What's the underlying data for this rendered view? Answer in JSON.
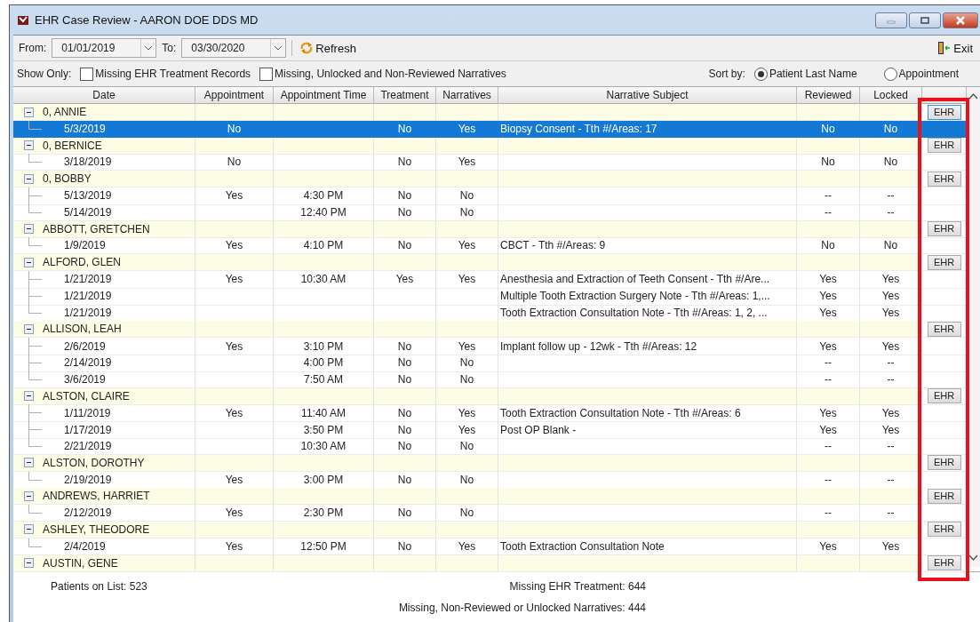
{
  "window": {
    "title": "EHR Case Review - AARON DOE DDS MD"
  },
  "toolbar": {
    "from_label": "From:",
    "from_date": "01/01/2019",
    "to_label": "To:",
    "to_date": "03/30/2020",
    "refresh": "Refresh",
    "exit": "Exit"
  },
  "filters": {
    "show_only_label": "Show Only:",
    "checkboxes": [
      {
        "label": "Missing EHR Treatment Records",
        "checked": false
      },
      {
        "label": "Missing, Unlocked and Non-Reviewed Narratives",
        "checked": false
      }
    ],
    "sort_label": "Sort by:",
    "sort_options": [
      {
        "label": "Patient Last Name",
        "selected": true
      },
      {
        "label": "Appointment",
        "selected": false
      }
    ]
  },
  "table": {
    "columns": [
      "Date",
      "Appointment",
      "Appointment Time",
      "Treatment",
      "Narratives",
      "Narrative Subject",
      "Reviewed",
      "Locked"
    ],
    "ehr_column_highlighted": true,
    "patients": [
      {
        "name": "0, ANNIE",
        "expanded": true,
        "ehr_button": "EHR",
        "focused": true,
        "visits": [
          {
            "date": "5/3/2019",
            "appointment": "No",
            "treatment": "No",
            "narratives": "Yes",
            "subject": "Biopsy Consent - Tth #/Areas: 17",
            "reviewed": "No",
            "locked": "No",
            "selected": true
          }
        ]
      },
      {
        "name": "0, BERNICE",
        "expanded": true,
        "ehr_button": "EHR",
        "focused": false,
        "visits": [
          {
            "date": "3/18/2019",
            "appointment": "No",
            "treatment": "No",
            "narratives": "Yes",
            "reviewed": "No",
            "locked": "No",
            "selected": false
          }
        ]
      },
      {
        "name": "0, BOBBY",
        "expanded": true,
        "ehr_button": "EHR",
        "focused": false,
        "visits": [
          {
            "date": "5/13/2019",
            "appointment": "Yes",
            "time": "4:30 PM",
            "treatment": "No",
            "narratives": "No",
            "reviewed": "--",
            "locked": "--",
            "selected": false
          },
          {
            "date": "5/14/2019",
            "time": "12:40 PM",
            "treatment": "No",
            "narratives": "No",
            "reviewed": "--",
            "locked": "--",
            "selected": false
          }
        ]
      },
      {
        "name": "ABBOTT, GRETCHEN",
        "expanded": true,
        "ehr_button": "EHR",
        "focused": false,
        "visits": [
          {
            "date": "1/9/2019",
            "appointment": "Yes",
            "time": "4:10 PM",
            "treatment": "No",
            "narratives": "Yes",
            "subject": "CBCT - Tth #/Areas:  9",
            "reviewed": "No",
            "locked": "No",
            "selected": false
          }
        ]
      },
      {
        "name": "ALFORD, GLEN",
        "expanded": true,
        "ehr_button": "EHR",
        "focused": false,
        "visits": [
          {
            "date": "1/21/2019",
            "appointment": "Yes",
            "time": "10:30 AM",
            "treatment": "Yes",
            "narratives": "Yes",
            "subject": "Anesthesia and Extraction of Teeth Consent - Tth #/Are...",
            "reviewed": "Yes",
            "locked": "Yes",
            "selected": false
          },
          {
            "date": "1/21/2019",
            "subject": "Multiple Tooth Extraction Surgery Note - Tth #/Areas: 1,...",
            "reviewed": "Yes",
            "locked": "Yes",
            "selected": false
          },
          {
            "date": "1/21/2019",
            "subject": "Tooth Extraction Consultation Note - Tth #/Areas: 1, 2, ...",
            "reviewed": "Yes",
            "locked": "Yes",
            "selected": false
          }
        ]
      },
      {
        "name": "ALLISON, LEAH",
        "expanded": true,
        "ehr_button": "EHR",
        "focused": false,
        "visits": [
          {
            "date": "2/6/2019",
            "appointment": "Yes",
            "time": "3:10 PM",
            "treatment": "No",
            "narratives": "Yes",
            "subject": "Implant follow up - 12wk - Tth #/Areas: 12",
            "reviewed": "Yes",
            "locked": "Yes",
            "selected": false
          },
          {
            "date": "2/14/2019",
            "time": "4:00 PM",
            "treatment": "No",
            "narratives": "No",
            "reviewed": "--",
            "locked": "--",
            "selected": false
          },
          {
            "date": "3/6/2019",
            "time": "7:50 AM",
            "treatment": "No",
            "narratives": "No",
            "reviewed": "--",
            "locked": "--",
            "selected": false
          }
        ]
      },
      {
        "name": "ALSTON, CLAIRE",
        "expanded": true,
        "ehr_button": "EHR",
        "focused": false,
        "visits": [
          {
            "date": "1/11/2019",
            "appointment": "Yes",
            "time": "11:40 AM",
            "treatment": "No",
            "narratives": "Yes",
            "subject": "Tooth Extraction Consultation Note - Tth #/Areas: 6",
            "reviewed": "Yes",
            "locked": "Yes",
            "selected": false
          },
          {
            "date": "1/17/2019",
            "time": "3:50 PM",
            "treatment": "No",
            "narratives": "Yes",
            "subject": "Post OP Blank -",
            "reviewed": "Yes",
            "locked": "Yes",
            "selected": false
          },
          {
            "date": "2/21/2019",
            "time": "10:30 AM",
            "treatment": "No",
            "narratives": "No",
            "reviewed": "--",
            "locked": "--",
            "selected": false
          }
        ]
      },
      {
        "name": "ALSTON, DOROTHY",
        "expanded": true,
        "ehr_button": "EHR",
        "focused": false,
        "visits": [
          {
            "date": "2/19/2019",
            "appointment": "Yes",
            "time": "3:00 PM",
            "treatment": "No",
            "narratives": "No",
            "reviewed": "--",
            "locked": "--",
            "selected": false
          }
        ]
      },
      {
        "name": "ANDREWS, HARRIET",
        "expanded": true,
        "ehr_button": "EHR",
        "focused": false,
        "visits": [
          {
            "date": "2/12/2019",
            "appointment": "Yes",
            "time": "2:30 PM",
            "treatment": "No",
            "narratives": "No",
            "reviewed": "--",
            "locked": "--",
            "selected": false
          }
        ]
      },
      {
        "name": "ASHLEY, THEODORE",
        "expanded": true,
        "ehr_button": "EHR",
        "focused": false,
        "visits": [
          {
            "date": "2/4/2019",
            "appointment": "Yes",
            "time": "12:50 PM",
            "treatment": "No",
            "narratives": "Yes",
            "subject": "Tooth Extraction Consultation Note",
            "reviewed": "Yes",
            "locked": "Yes",
            "selected": false
          }
        ]
      },
      {
        "name": "AUSTIN, GENE",
        "expanded": true,
        "ehr_button": "EHR",
        "focused": false
      }
    ]
  },
  "footer": {
    "patients_on_list": "Patients on List:  523",
    "missing_ehr_treatment": "Missing EHR Treatment:  644",
    "missing_narratives": "Missing, Non-Reviewed or Unlocked Narratives:  444"
  }
}
